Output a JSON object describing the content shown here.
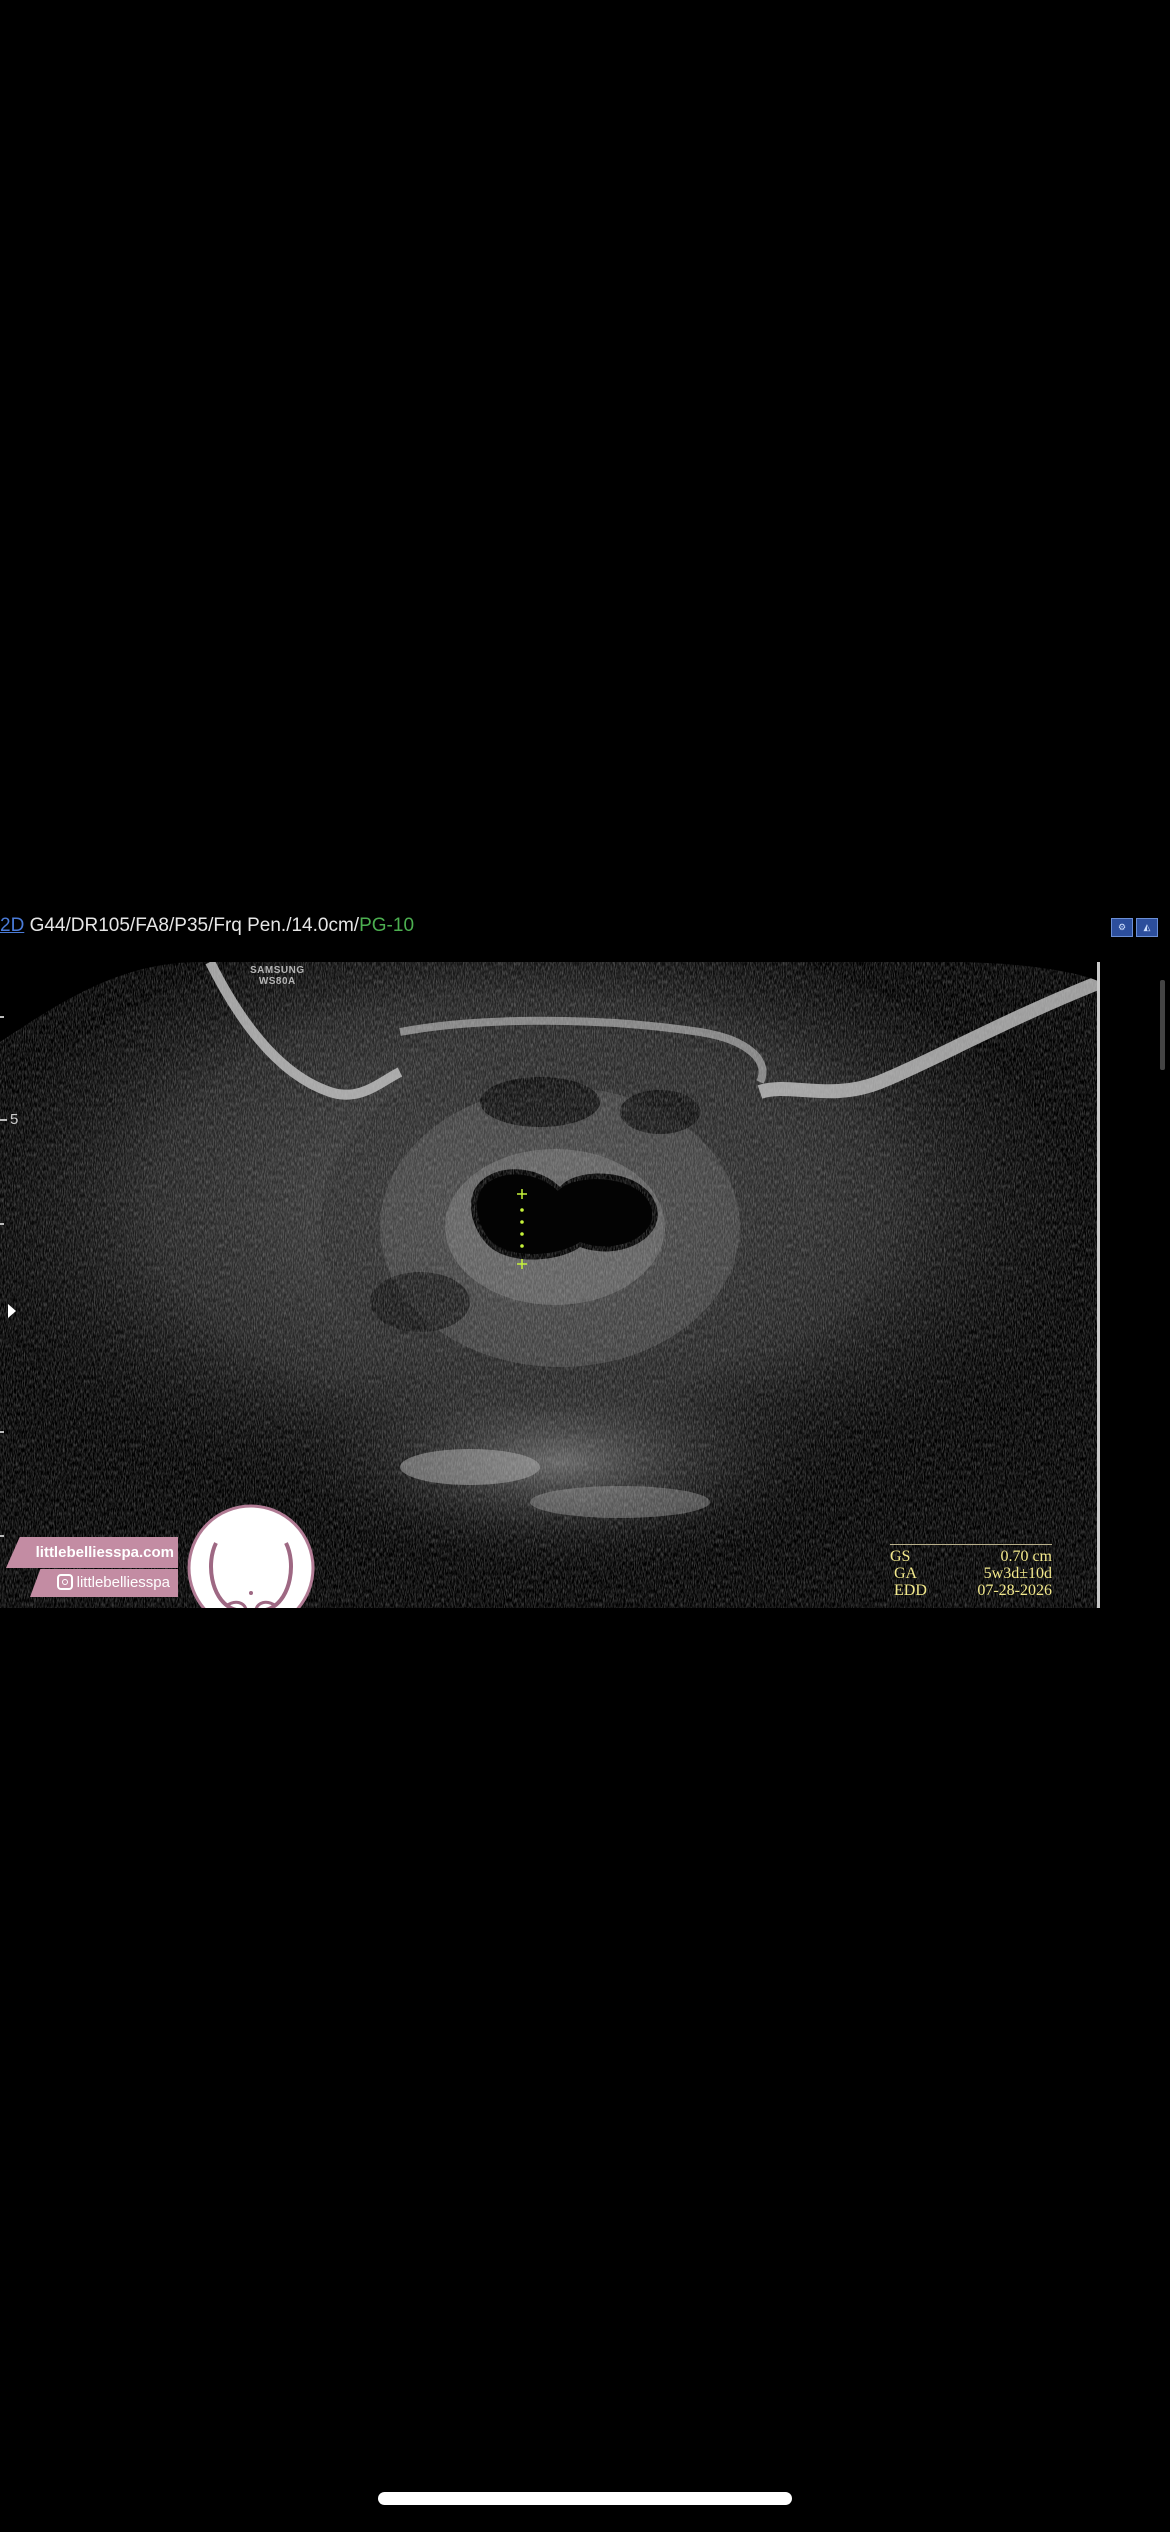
{
  "header": {
    "mode": "2D",
    "params": " G44/DR105/FA8/P35/Frq Pen./14.0cm/",
    "preset": "PG-10"
  },
  "device": {
    "brand": "SAMSUNG",
    "model": "WS80A"
  },
  "scale": {
    "depth_label": "5"
  },
  "measurements": [
    {
      "label": "GS",
      "value": "0.70 cm"
    },
    {
      "label": "GA",
      "value": "5w3d±10d"
    },
    {
      "label": "EDD",
      "value": "07-28-2026"
    }
  ],
  "watermark": {
    "website": "littlebelliesspa.com",
    "instagram": "littlebelliesspa"
  },
  "colors": {
    "mode": "#4a7bd8",
    "preset": "#4caf50",
    "measurement_text": "#f3e98c",
    "caliper": "#c6f23a",
    "watermark_band": "#c38ca3"
  },
  "icons": [
    "settings-icon",
    "probe-icon",
    "play-marker-icon",
    "instagram-icon"
  ]
}
